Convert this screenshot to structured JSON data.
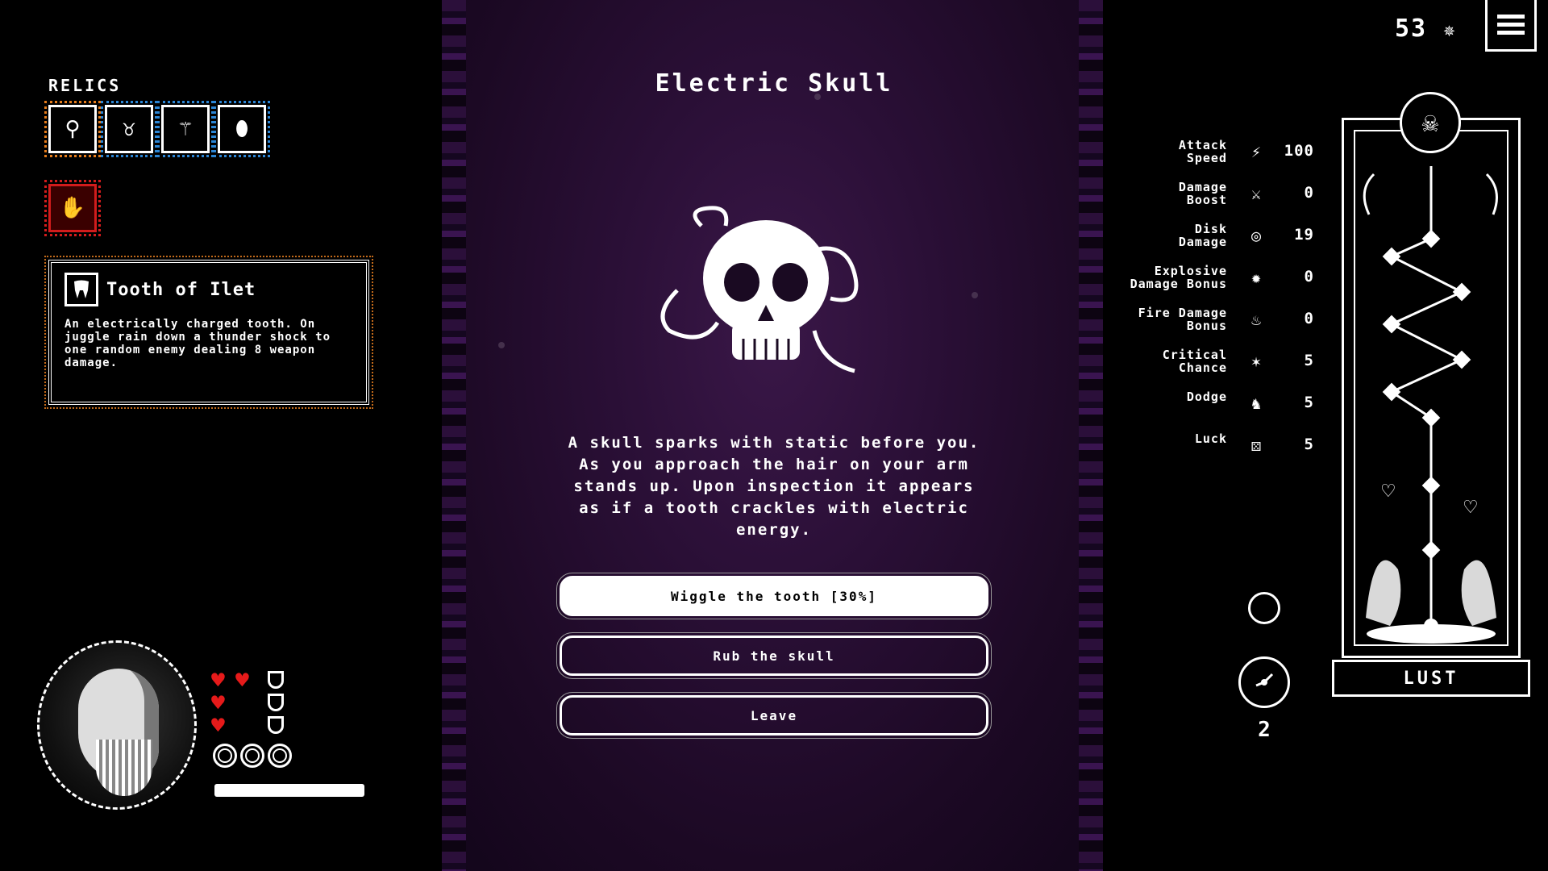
{
  "colors": {
    "background": "#000000",
    "column_purple": "#2a0f36",
    "relic_orange": "#e67c1a",
    "relic_blue": "#2b86d6",
    "curse_red": "#d21c1c",
    "heart_red": "#e61a1a",
    "text": "#ffffff"
  },
  "relics": {
    "title": "RELICS",
    "items": [
      {
        "icon": "relic-whip-icon",
        "glyph": "⚲"
      },
      {
        "icon": "relic-horns-icon",
        "glyph": "♉"
      },
      {
        "icon": "relic-trident-icon",
        "glyph": "⚚"
      },
      {
        "icon": "relic-egg-icon",
        "glyph": "⬮"
      }
    ],
    "curse": {
      "icon": "curse-hand-icon",
      "glyph": "✋"
    }
  },
  "tooltip": {
    "icon": "tooth-icon",
    "title": "Tooth of Ilet",
    "description": "An electrically charged tooth. On juggle rain down a thunder shock to one random enemy dealing 8 weapon damage."
  },
  "player": {
    "hearts_filled": 4,
    "shields": 3,
    "orbs": 3,
    "stamina_fraction": 1.0
  },
  "event": {
    "title": "Electric Skull",
    "description": "A skull sparks with static before you. As you approach the hair on your arm stands up. Upon inspection it appears as if a tooth crackles with electric energy.",
    "choices": [
      {
        "label": "Wiggle the tooth [30%]",
        "selected": true
      },
      {
        "label": "Rub the skull",
        "selected": false
      },
      {
        "label": "Leave",
        "selected": false
      }
    ]
  },
  "currency": {
    "value": "53",
    "icon": "soul-shard-icon",
    "glyph": "✵"
  },
  "stats": [
    {
      "label": "Attack\nSpeed",
      "icon": "attack-speed-icon",
      "glyph": "⚡",
      "value": "100"
    },
    {
      "label": "Damage\nBoost",
      "icon": "damage-boost-icon",
      "glyph": "⚔",
      "value": "0"
    },
    {
      "label": "Disk\nDamage",
      "icon": "disk-damage-icon",
      "glyph": "◎",
      "value": "19"
    },
    {
      "label": "Explosive\nDamage Bonus",
      "icon": "explosive-icon",
      "glyph": "✹",
      "value": "0"
    },
    {
      "label": "Fire Damage\nBonus",
      "icon": "fire-icon",
      "glyph": "♨",
      "value": "0"
    },
    {
      "label": "Critical\nChance",
      "icon": "critical-icon",
      "glyph": "✶",
      "value": "5"
    },
    {
      "label": "Dodge",
      "icon": "dodge-icon",
      "glyph": "♞",
      "value": "5"
    },
    {
      "label": "Luck",
      "icon": "dice-icon",
      "glyph": "⚄",
      "value": "5"
    }
  ],
  "tower": {
    "circle": "Lust",
    "label": "LUST",
    "levels": 8,
    "current_level": 1
  },
  "gauge": {
    "count": "2"
  }
}
